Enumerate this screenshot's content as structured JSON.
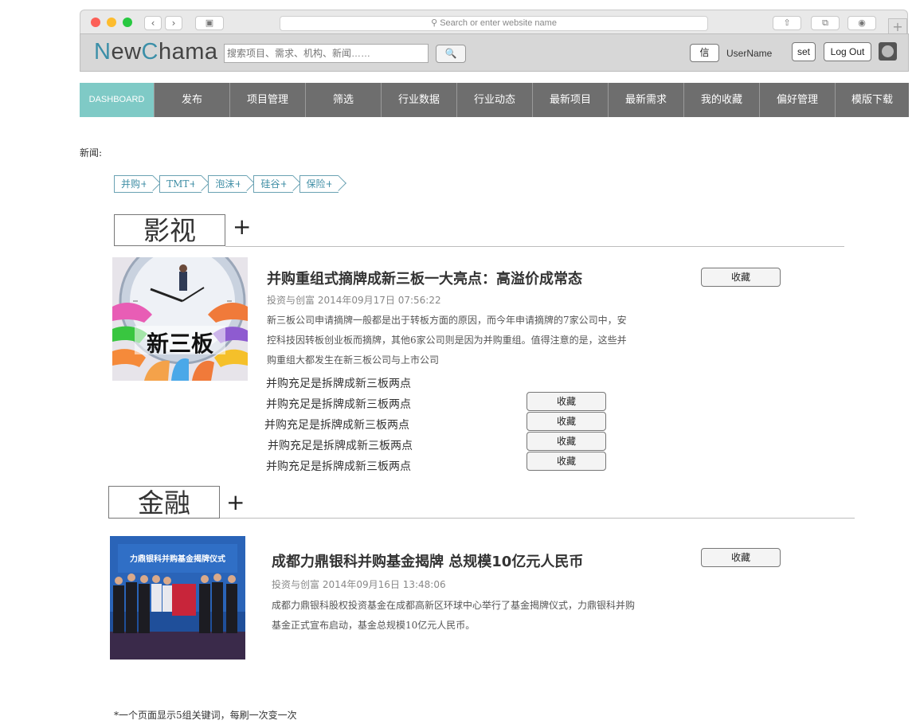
{
  "browser": {
    "address_placeholder": "Search or enter website name",
    "new_tab_label": "+"
  },
  "header": {
    "logo_parts": [
      "N",
      "ew",
      "C",
      "hama"
    ],
    "search_placeholder": "搜索项目、需求、机构、新闻……",
    "message_label": "信",
    "username": "UserName",
    "set_label": "set",
    "logout_label": "Log Out"
  },
  "nav": {
    "items": [
      "DASHBOARD",
      "发布",
      "项目管理",
      "筛选",
      "行业数据",
      "行业动态",
      "最新项目",
      "最新需求",
      "我的收藏",
      "偏好管理",
      "模版下载"
    ]
  },
  "news_label": "新闻:",
  "tags": [
    "并购+",
    "TMT+",
    "泡沫+",
    "硅谷+",
    "保险+"
  ],
  "sections": [
    {
      "title": "影视",
      "plus": "+",
      "featured": {
        "image_text": "新三板",
        "title": "并购重组式摘牌成新三板一大亮点：高溢价成常态",
        "meta": "投资与创富 2014年09月17日 07:56:22",
        "body_lines": [
          "新三板公司申请摘牌一般都是出于转板方面的原因，而今年申请摘牌的7家公司中，安",
          "控科技因转板创业板而摘牌，其他6家公司则是因为并购重组。值得注意的是，这些并",
          "购重组大都发生在新三板公司与上市公司"
        ],
        "fav_label": "收藏"
      },
      "list": [
        {
          "text": "并购充足是拆牌成新三板两点"
        },
        {
          "text": "并购充足是拆牌成新三板两点",
          "fav_label": "收藏"
        },
        {
          "text": "并购充足是拆牌成新三板两点",
          "fav_label": "收藏"
        },
        {
          "text": "并购充足是拆牌成新三板两点",
          "fav_label": "收藏"
        },
        {
          "text": "并购充足是拆牌成新三板两点",
          "fav_label": "收藏"
        }
      ]
    },
    {
      "title": "金融",
      "plus": "+",
      "featured": {
        "banner_text": "力鼎银科并购基金揭牌仪式",
        "title": "成都力鼎银科并购基金揭牌 总规模10亿元人民币",
        "meta": "投资与创富 2014年09月16日 13:48:06",
        "body_lines": [
          "成都力鼎银科股权投资基金在成都高新区环球中心举行了基金揭牌仪式，力鼎银科并购",
          "基金正式宣布启动，基金总规模10亿元人民币。"
        ],
        "fav_label": "收藏"
      }
    }
  ],
  "footnote": "*一个页面显示5组关键词，每刷一次变一次"
}
